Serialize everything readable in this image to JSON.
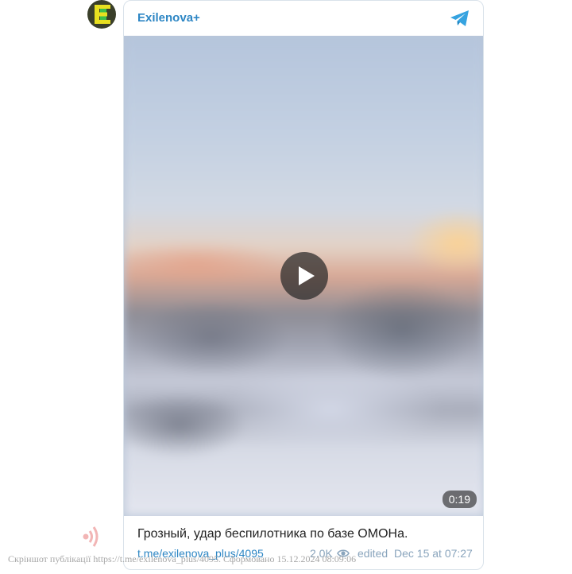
{
  "channel": {
    "name": "Exilenova+",
    "avatar_icon": "exilenova-logo",
    "logo_colors": [
      "#e8e020",
      "#3cbf4a"
    ]
  },
  "header": {
    "telegram_icon": "telegram-icon",
    "accent": "#2d86c4"
  },
  "video": {
    "duration": "0:19",
    "play_icon": "play-icon"
  },
  "post": {
    "caption": "Грозный, удар беспилотника по базе ОМОНа.",
    "link": "t.me/exilenova_plus/4095",
    "views": "2.0K",
    "edited": "edited",
    "date": "Dec 15 at 07:27"
  },
  "watermark": "Скріншот публікації https://t.me/exilenova_plus/4095. Сформовано 15.12.2024 08:09:06"
}
